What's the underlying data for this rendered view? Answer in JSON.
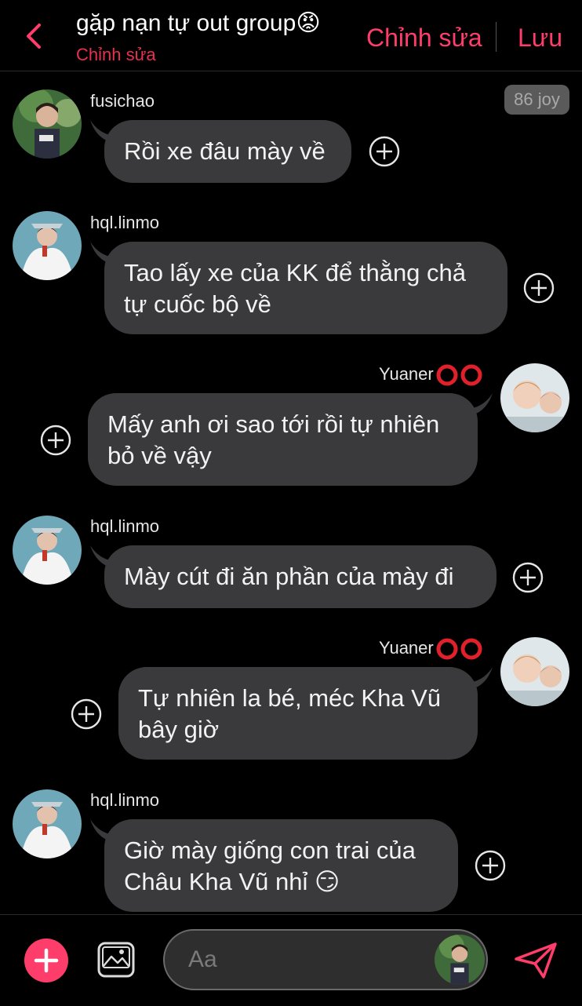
{
  "header": {
    "title": "gặp nạn tự out group",
    "title_emoji": "😡",
    "subtitle": "Chỉnh sửa",
    "edit_label": "Chỉnh sửa",
    "save_label": "Lưu"
  },
  "badge": "86 joy",
  "messages": [
    {
      "sender": "fusichao",
      "text": "Rồi xe đâu mày về",
      "side": "left"
    },
    {
      "sender": "hql.linmo",
      "text": "Tao lấy xe của KK để thằng chả\ntự cuốc bộ về",
      "side": "left"
    },
    {
      "sender": "Yuaner",
      "text": "Mấy anh ơi sao tới rồi tự nhiên\nbỏ về vậy",
      "side": "right"
    },
    {
      "sender": "hql.linmo",
      "text": "Mày cút đi ăn phần của mày đi",
      "side": "left"
    },
    {
      "sender": "Yuaner",
      "text": "Tự nhiên la bé, méc Kha Vũ\nbây giờ",
      "side": "right"
    },
    {
      "sender": "hql.linmo",
      "text": "Giờ mày giống con trai của\nChâu Kha Vũ nhỉ 😏",
      "side": "left"
    }
  ],
  "composer": {
    "placeholder": "Aa"
  },
  "colors": {
    "accent": "#ff3d6a",
    "bubble": "#3a3a3c",
    "background": "#000000"
  },
  "icons": [
    "back-chevron-icon",
    "plus-circle-icon",
    "image-icon",
    "send-icon",
    "red-circle-emoji"
  ]
}
